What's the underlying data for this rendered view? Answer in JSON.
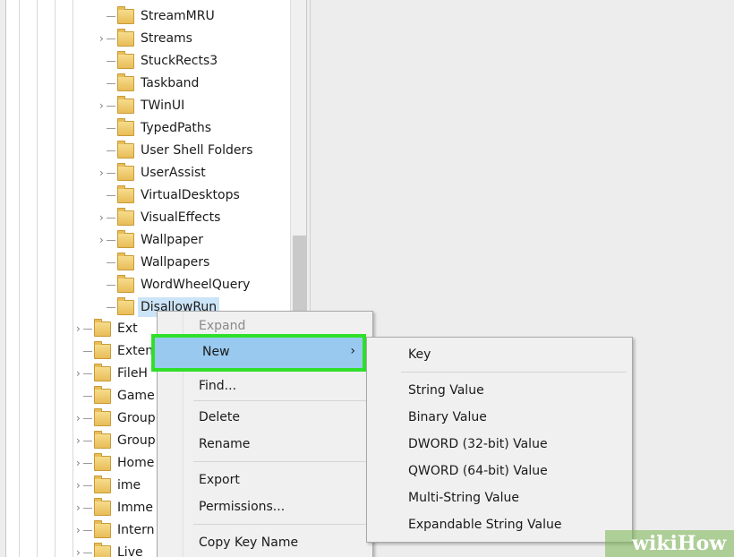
{
  "tree": {
    "upper_items": [
      {
        "label": "StreamMRU",
        "expandable": false
      },
      {
        "label": "Streams",
        "expandable": true
      },
      {
        "label": "StuckRects3",
        "expandable": false
      },
      {
        "label": "Taskband",
        "expandable": false
      },
      {
        "label": "TWinUI",
        "expandable": true
      },
      {
        "label": "TypedPaths",
        "expandable": false
      },
      {
        "label": "User Shell Folders",
        "expandable": false
      },
      {
        "label": "UserAssist",
        "expandable": true
      },
      {
        "label": "VirtualDesktops",
        "expandable": false
      },
      {
        "label": "VisualEffects",
        "expandable": true
      },
      {
        "label": "Wallpaper",
        "expandable": true
      },
      {
        "label": "Wallpapers",
        "expandable": false
      },
      {
        "label": "WordWheelQuery",
        "expandable": false
      },
      {
        "label": "DisallowRun",
        "expandable": false,
        "selected": true
      }
    ],
    "lower_items": [
      {
        "label": "Ext",
        "expandable": true
      },
      {
        "label": "Exten",
        "expandable": false
      },
      {
        "label": "FileH",
        "expandable": true
      },
      {
        "label": "Game",
        "expandable": false
      },
      {
        "label": "Group",
        "expandable": true
      },
      {
        "label": "Group",
        "expandable": true
      },
      {
        "label": "Home",
        "expandable": true
      },
      {
        "label": "ime",
        "expandable": true
      },
      {
        "label": "Imme",
        "expandable": true
      },
      {
        "label": "Intern",
        "expandable": true
      },
      {
        "label": "Live",
        "expandable": true
      }
    ]
  },
  "context_menu": {
    "expand": "Expand",
    "new": "New",
    "new_arrow": "›",
    "find": "Find...",
    "delete": "Delete",
    "rename": "Rename",
    "export": "Export",
    "permissions": "Permissions...",
    "copy_key_name": "Copy Key Name"
  },
  "submenu": {
    "key": "Key",
    "string_value": "String Value",
    "binary_value": "Binary Value",
    "dword_value": "DWORD (32-bit) Value",
    "qword_value": "QWORD (64-bit) Value",
    "multi_string_value": "Multi-String Value",
    "expandable_string_value": "Expandable String Value"
  },
  "watermark": {
    "text": "wikiHow"
  },
  "colors": {
    "highlight_border": "#2fdf2a",
    "menu_hover": "#99c9ef",
    "selection": "#cce4f7",
    "folder": "#e8bd58"
  }
}
